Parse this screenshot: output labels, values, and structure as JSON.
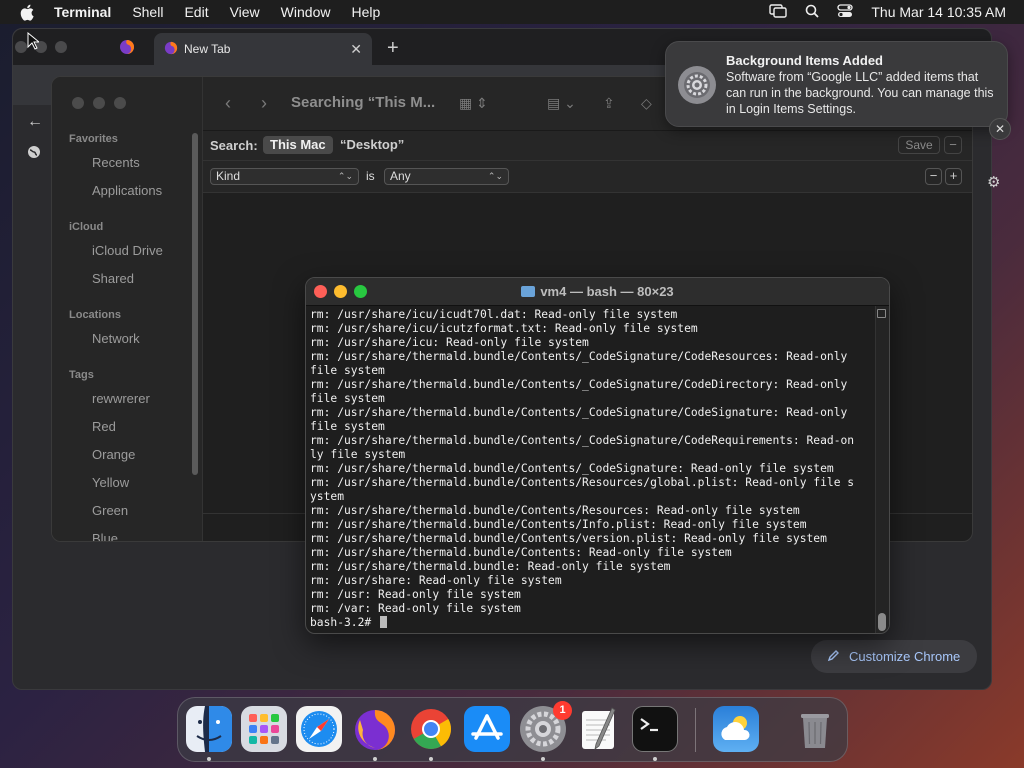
{
  "menubar": {
    "app_name": "Terminal",
    "items": [
      "Shell",
      "Edit",
      "View",
      "Window",
      "Help"
    ],
    "clock": "Thu Mar 14  10:35 AM"
  },
  "chrome": {
    "active_tab_title": "New Tab",
    "customize_label": "Customize Chrome"
  },
  "finder": {
    "title": "Searching “This M...",
    "sidebar": {
      "favorites_header": "Favorites",
      "favorites": [
        "Recents",
        "Applications"
      ],
      "icloud_header": "iCloud",
      "icloud": [
        "iCloud Drive",
        "Shared"
      ],
      "locations_header": "Locations",
      "locations": [
        "Network"
      ],
      "tags_header": "Tags",
      "tags": [
        "rewwrerer",
        "Red",
        "Orange",
        "Yellow",
        "Green",
        "Blue"
      ]
    },
    "search": {
      "label": "Search:",
      "scope_active": "This Mac",
      "scope_other": "“Desktop”",
      "save_label": "Save"
    },
    "criteria": {
      "attribute": "Kind",
      "operator": "is",
      "value": "Any"
    }
  },
  "notification": {
    "title": "Background Items Added",
    "body": "Software from “Google LLC” added items that can run in the background. You can manage this in Login Items Settings."
  },
  "terminal": {
    "title": "vm4 — bash — 80×23",
    "lines": [
      "rm: /usr/share/icu/icudt70l.dat: Read-only file system",
      "rm: /usr/share/icu/icutzformat.txt: Read-only file system",
      "rm: /usr/share/icu: Read-only file system",
      "rm: /usr/share/thermald.bundle/Contents/_CodeSignature/CodeResources: Read-only",
      "file system",
      "rm: /usr/share/thermald.bundle/Contents/_CodeSignature/CodeDirectory: Read-only",
      "file system",
      "rm: /usr/share/thermald.bundle/Contents/_CodeSignature/CodeSignature: Read-only",
      "file system",
      "rm: /usr/share/thermald.bundle/Contents/_CodeSignature/CodeRequirements: Read-on",
      "ly file system",
      "rm: /usr/share/thermald.bundle/Contents/_CodeSignature: Read-only file system",
      "rm: /usr/share/thermald.bundle/Contents/Resources/global.plist: Read-only file s",
      "ystem",
      "rm: /usr/share/thermald.bundle/Contents/Resources: Read-only file system",
      "rm: /usr/share/thermald.bundle/Contents/Info.plist: Read-only file system",
      "rm: /usr/share/thermald.bundle/Contents/version.plist: Read-only file system",
      "rm: /usr/share/thermald.bundle/Contents: Read-only file system",
      "rm: /usr/share/thermald.bundle: Read-only file system",
      "rm: /usr/share: Read-only file system",
      "rm: /usr: Read-only file system",
      "rm: /var: Read-only file system"
    ],
    "prompt": "bash-3.2# "
  },
  "dock": {
    "settings_badge": "1"
  },
  "icons": {
    "apple": "apple-icon",
    "finder": "finder-icon",
    "launchpad": "launchpad-icon",
    "safari": "safari-icon",
    "firefox": "firefox-icon",
    "chrome": "chrome-icon",
    "app_store": "app-store-icon",
    "system_settings": "system-settings-icon",
    "textedit": "textedit-icon",
    "terminal": "terminal-icon",
    "weather": "weather-icon",
    "trash": "trash-icon"
  },
  "colors": {
    "close": "#fe5f57",
    "minimize": "#febc2e",
    "zoom": "#28c840",
    "chrome_accent": "#a8c7fa",
    "badge": "#ff3b30"
  }
}
